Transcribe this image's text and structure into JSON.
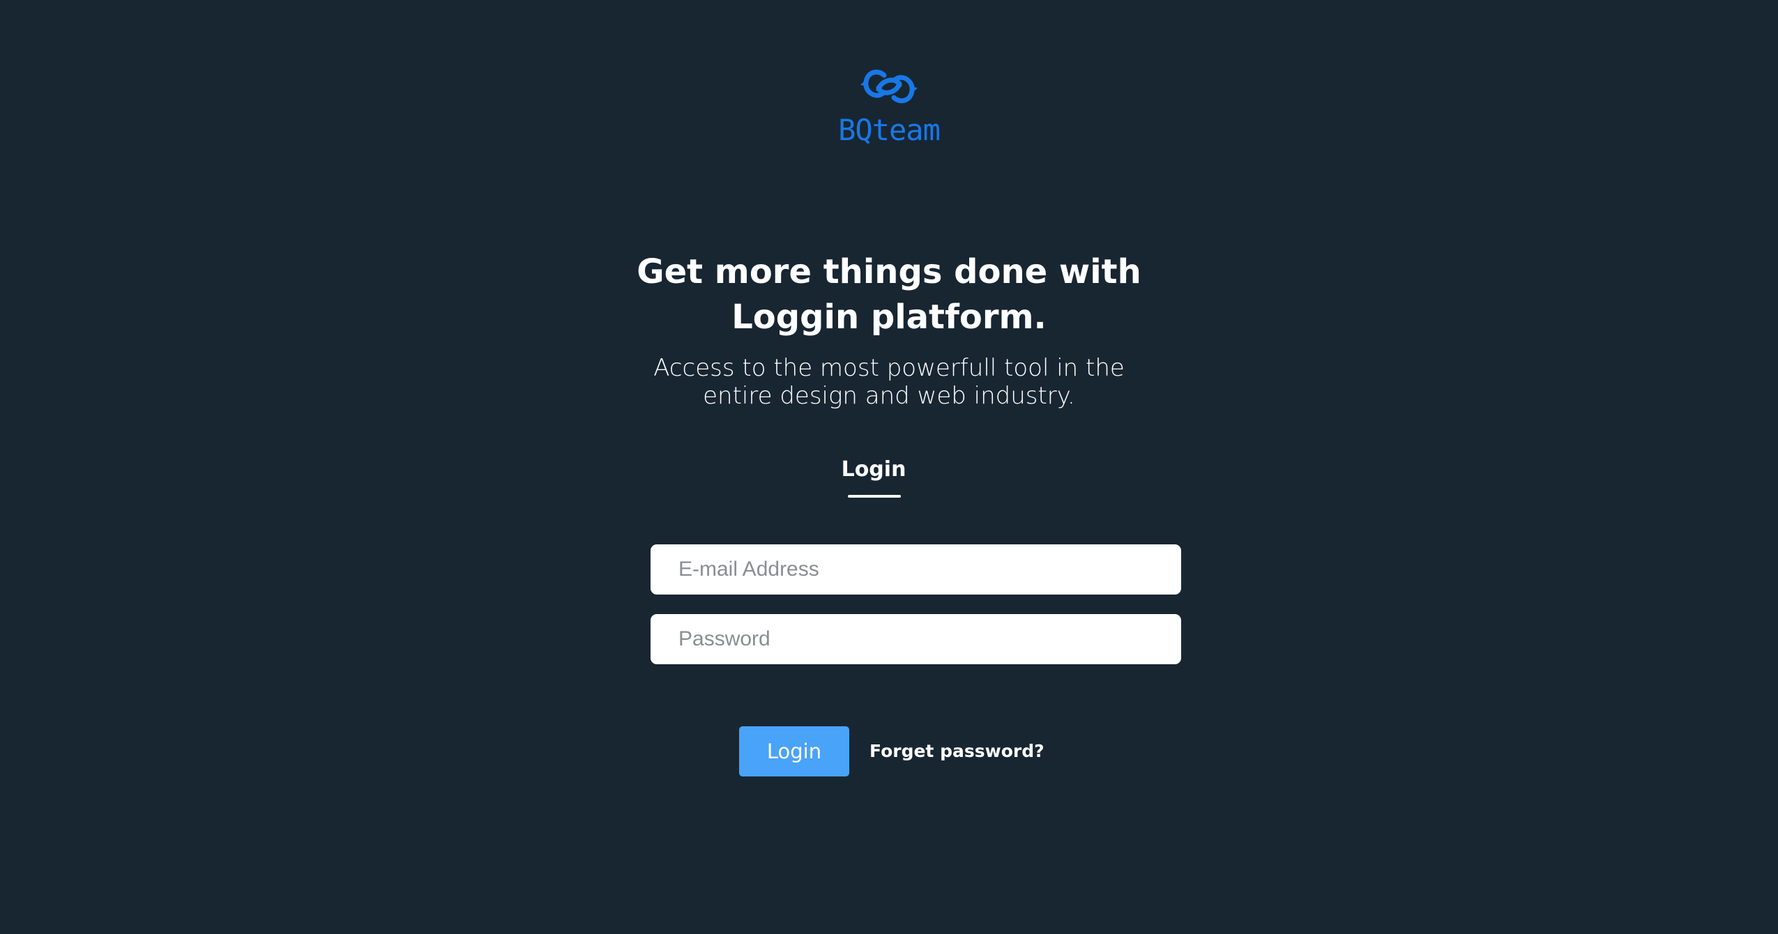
{
  "brand": {
    "name": "BQteam",
    "logo_icon": "linked-rings-icon",
    "color": "#1878e6"
  },
  "hero": {
    "title_line1": "Get more things done with",
    "title_line2": "Loggin platform.",
    "subtitle_line1": "Access to the most powerfull tool in the",
    "subtitle_line2": "entire design and web industry."
  },
  "tabs": {
    "active_label": "Login"
  },
  "form": {
    "email": {
      "placeholder": "E-mail Address",
      "value": ""
    },
    "password": {
      "placeholder": "Password",
      "value": ""
    },
    "submit_label": "Login",
    "forgot_label": "Forget password?"
  },
  "colors": {
    "background": "#182632",
    "accent": "#49a3f8",
    "brand": "#1878e6",
    "text": "#ffffff"
  }
}
